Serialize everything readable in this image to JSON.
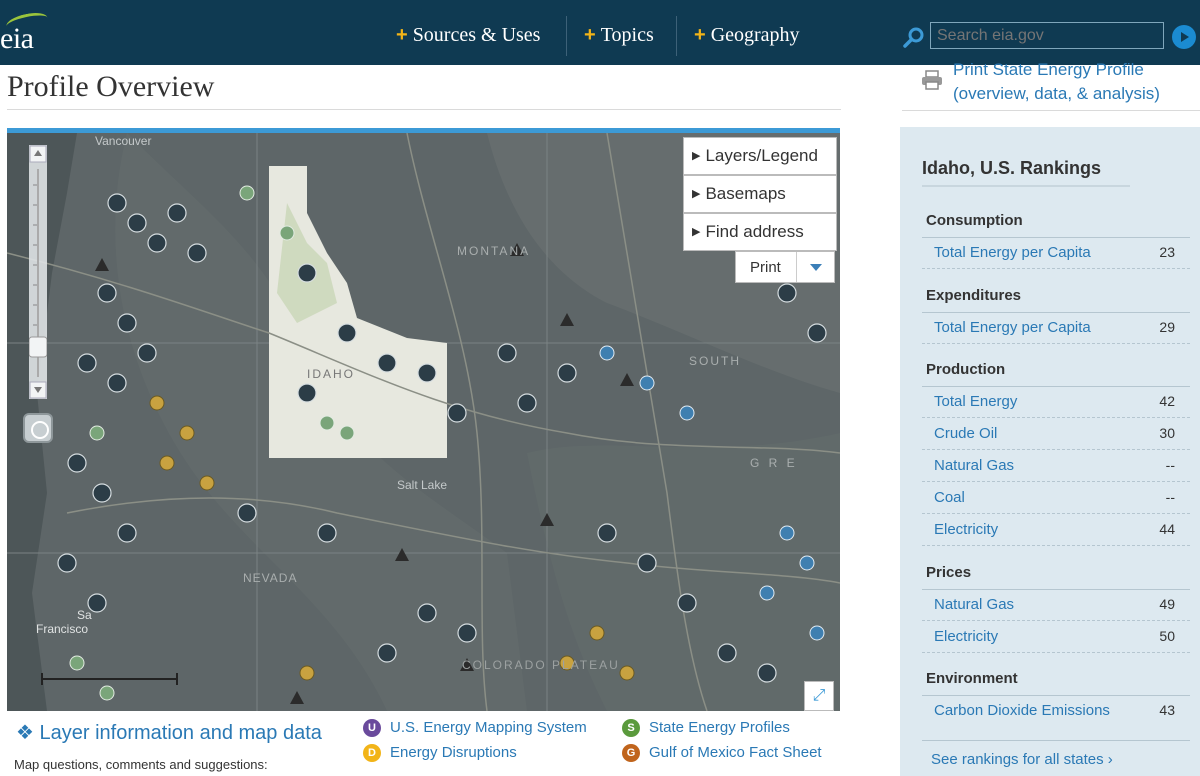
{
  "header": {
    "logo_text": "eia",
    "nav": [
      {
        "label": "Sources & Uses"
      },
      {
        "label": "Topics"
      },
      {
        "label": "Geography"
      }
    ],
    "search_placeholder": "Search eia.gov"
  },
  "page": {
    "title": "Profile Overview"
  },
  "map": {
    "buttons": {
      "layers": "Layers/Legend",
      "basemaps": "Basemaps",
      "find_address": "Find address",
      "print": "Print"
    },
    "labels": [
      "Vancouver",
      "MONTANA",
      "IDAHO",
      "SOUTH",
      "G R E",
      "Salt Lake",
      "Sa",
      "Francisco",
      "NEVADA",
      "COLORADO PLATEAU"
    ]
  },
  "below_map": {
    "layer_info": "Layer information and map data",
    "questions": "Map questions, comments and suggestions:",
    "links": [
      {
        "badge": "U",
        "color": "#6a4a9c",
        "label": "U.S. Energy Mapping System"
      },
      {
        "badge": "S",
        "color": "#5a9a3c",
        "label": "State Energy Profiles"
      },
      {
        "badge": "D",
        "color": "#f2b418",
        "label": "Energy Disruptions"
      },
      {
        "badge": "G",
        "color": "#c0641c",
        "label": "Gulf of Mexico Fact Sheet"
      }
    ]
  },
  "sidebar": {
    "print_link": "Print State Energy Profile (overview, data, & analysis)",
    "rankings_title": "Idaho, U.S. Rankings",
    "sections": [
      {
        "name": "Consumption",
        "rows": [
          {
            "label": "Total Energy per Capita",
            "value": "23"
          }
        ]
      },
      {
        "name": "Expenditures",
        "rows": [
          {
            "label": "Total Energy per Capita",
            "value": "29"
          }
        ]
      },
      {
        "name": "Production",
        "rows": [
          {
            "label": "Total Energy",
            "value": "42"
          },
          {
            "label": "Crude Oil",
            "value": "30"
          },
          {
            "label": "Natural Gas",
            "value": "--"
          },
          {
            "label": "Coal",
            "value": "--"
          },
          {
            "label": "Electricity",
            "value": "44"
          }
        ]
      },
      {
        "name": "Prices",
        "rows": [
          {
            "label": "Natural Gas",
            "value": "49"
          },
          {
            "label": "Electricity",
            "value": "50"
          }
        ]
      },
      {
        "name": "Environment",
        "rows": [
          {
            "label": "Carbon Dioxide Emissions",
            "value": "43"
          }
        ]
      }
    ],
    "see_all": "See rankings for all states ›"
  },
  "colors": {
    "header_bg": "#0f3a52",
    "accent_plus": "#f2b418",
    "link": "#2a79b5",
    "rankings_bg": "#dde9f0",
    "map_border": "#3c9ad6"
  }
}
